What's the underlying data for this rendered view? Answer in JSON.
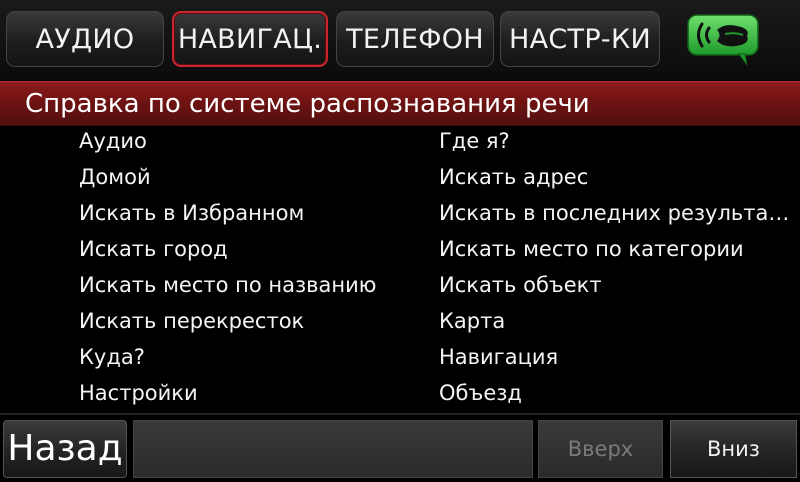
{
  "tabs": {
    "audio": "АУДИО",
    "navigation": "НАВИГАЦ.",
    "phone": "ТЕЛЕФОН",
    "settings": "НАСТР-КИ",
    "active": "navigation"
  },
  "voice_button": {
    "icon": "speech-bubble-voice-icon",
    "color": "#3cbf3c"
  },
  "title": "Справка по системе распознавания речи",
  "list": {
    "left": [
      "Аудио",
      "Домой",
      "Искать в Избранном",
      "Искать город",
      "Искать место по названию",
      "Искать перекресток",
      "Куда?",
      "Настройки"
    ],
    "right": [
      "Где я?",
      "Искать адрес",
      "Искать в последних результатах",
      "Искать место по категории",
      "Искать объект",
      "Карта",
      "Навигация",
      "Объезд"
    ]
  },
  "bottom": {
    "back": "Назад",
    "up": "Вверх",
    "down": "Вниз",
    "up_disabled": true
  },
  "colors": {
    "accent_red": "#c8262c",
    "title_band": "#6d1212",
    "voice_green": "#3cbf3c"
  }
}
